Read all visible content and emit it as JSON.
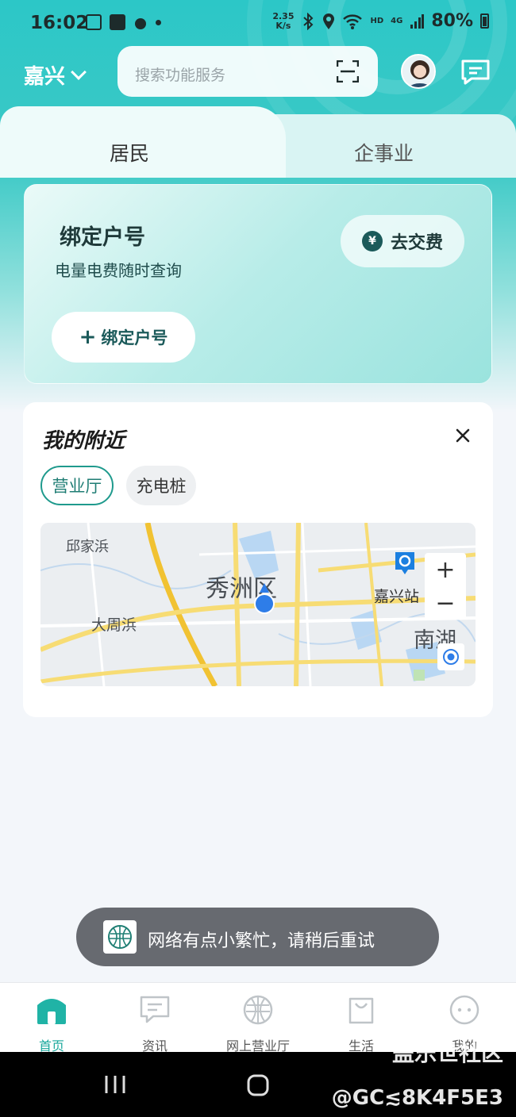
{
  "status_bar": {
    "time": "16:02",
    "speed_value": "2.35",
    "speed_unit": "K/s",
    "network": "4G",
    "hd": "HD",
    "battery": "80%"
  },
  "header": {
    "city": "嘉兴",
    "search_placeholder": "搜索功能服务"
  },
  "tabs": [
    {
      "label": "居民",
      "active": true
    },
    {
      "label": "企事业",
      "active": false
    }
  ],
  "bind_card": {
    "title": "绑定户号",
    "subtitle": "电量电费随时查询",
    "pay_icon_glyph": "¥",
    "pay_label": "去交费",
    "bind_label": "绑定户号"
  },
  "nearby": {
    "title": "我的附近",
    "chips": [
      {
        "label": "营业厅",
        "active": true
      },
      {
        "label": "充电桩",
        "active": false
      }
    ],
    "map": {
      "labels": [
        "邱家浜",
        "秀洲区",
        "大周浜",
        "嘉兴站",
        "南湖"
      ],
      "zoom_in": "+",
      "zoom_out": "−"
    }
  },
  "toast": {
    "message": "网络有点小繁忙，请稍后重试"
  },
  "bottom_nav": [
    {
      "label": "首页",
      "icon": "home-icon",
      "active": true
    },
    {
      "label": "资讯",
      "icon": "news-icon",
      "active": false
    },
    {
      "label": "网上营业厅",
      "icon": "online-hall-icon",
      "active": false
    },
    {
      "label": "生活",
      "icon": "life-bag-icon",
      "active": false
    },
    {
      "label": "我的",
      "icon": "profile-icon",
      "active": false
    }
  ],
  "watermark": {
    "line1": "盖乐世社区",
    "line2": "@GC≲8K4F5E3"
  },
  "colors": {
    "accent": "#18a79b",
    "header_teal": "#2cc7c7",
    "toast_bg": "#5f6268"
  }
}
